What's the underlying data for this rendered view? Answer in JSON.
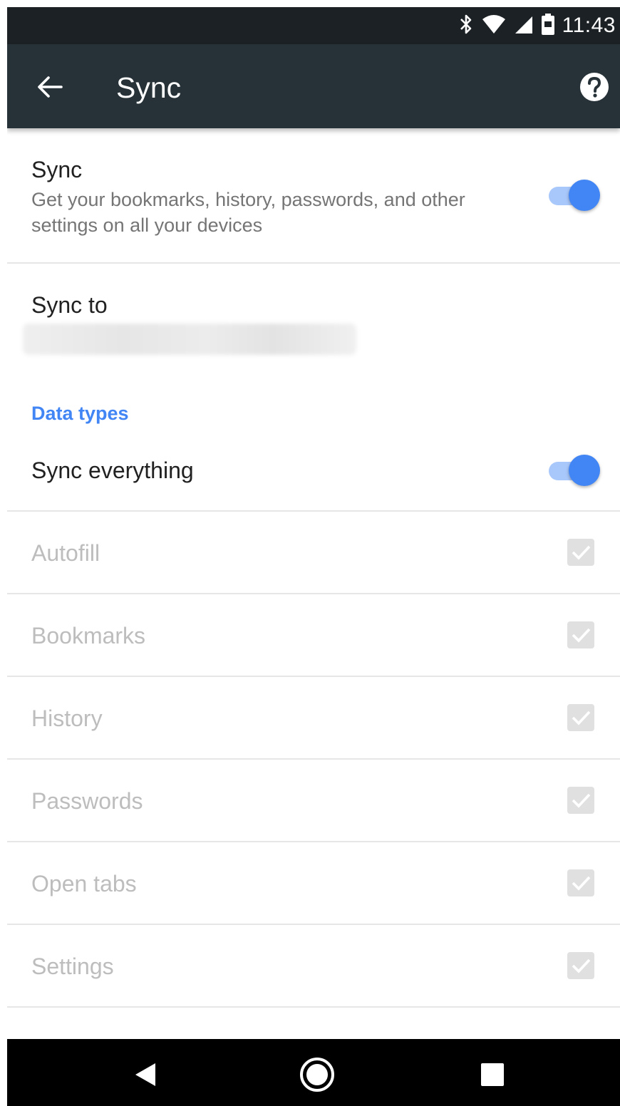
{
  "status_bar": {
    "time": "11:43",
    "icons": [
      "bluetooth-icon",
      "wifi-icon",
      "signal-icon",
      "battery-icon"
    ]
  },
  "app_bar": {
    "title": "Sync",
    "back_icon": "arrow-left-icon",
    "help_icon": "help-circle-icon",
    "background": "#263238"
  },
  "sync": {
    "title": "Sync",
    "description": "Get your bookmarks, history, passwords, and other settings on all your devices",
    "enabled": true
  },
  "sync_to": {
    "title": "Sync to"
  },
  "data_types": {
    "header": "Data types",
    "sync_everything": {
      "label": "Sync everything",
      "enabled": true
    },
    "items": [
      {
        "label": "Autofill",
        "checked": true
      },
      {
        "label": "Bookmarks",
        "checked": true
      },
      {
        "label": "History",
        "checked": true
      },
      {
        "label": "Passwords",
        "checked": true
      },
      {
        "label": "Open tabs",
        "checked": true
      },
      {
        "label": "Settings",
        "checked": true
      }
    ]
  },
  "nav_bar": {
    "buttons": [
      "back-triangle-icon",
      "home-circle-icon",
      "recents-square-icon"
    ]
  },
  "colors": {
    "accent": "#4285f4",
    "toggle_track": "#a8c7fa",
    "disabled_text": "#bdbdbd"
  }
}
